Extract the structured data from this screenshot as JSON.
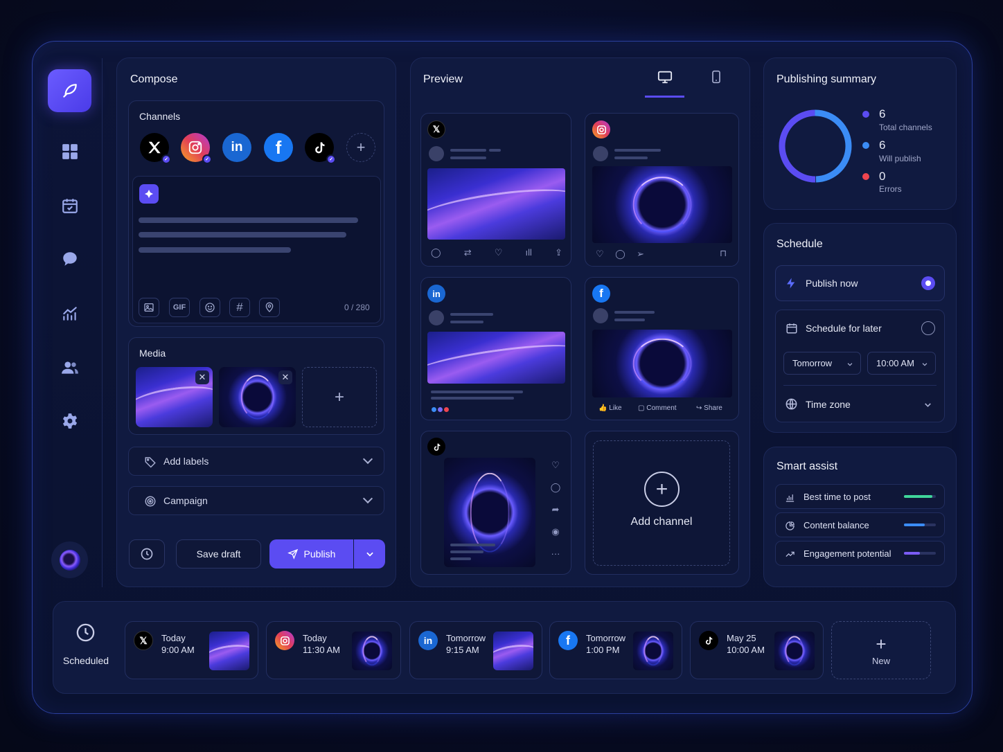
{
  "compose": {
    "title": "Compose",
    "channels_title": "Channels",
    "char_count": "0 / 280",
    "tools": [
      "image-icon",
      "GIF",
      "emoji-icon",
      "#",
      "location-icon"
    ],
    "media_title": "Media",
    "add_labels": "Add labels",
    "campaign": "Campaign",
    "save_draft": "Save draft",
    "publish": "Publish"
  },
  "preview": {
    "title": "Preview",
    "active_device": "desktop",
    "fb_like": "Like",
    "fb_comment": "Comment",
    "fb_share": "Share",
    "add_channel": "Add channel"
  },
  "summary": {
    "title": "Publishing summary",
    "total_value": "6",
    "total_label": "Total channels",
    "will_value": "6",
    "will_label": "Will publish",
    "errors_value": "0",
    "errors_label": "Errors",
    "colors": {
      "total": "#5b4cf2",
      "will": "#3b8cf5",
      "errors": "#f0454f"
    }
  },
  "schedule": {
    "title": "Schedule",
    "publish_now": "Publish now",
    "schedule_later": "Schedule for later",
    "day": "Tomorrow",
    "time": "10:00 AM",
    "timezone": "Time zone",
    "selected": "publish_now"
  },
  "assist": {
    "title": "Smart assist",
    "items": [
      {
        "label": "Best time to post",
        "level": 0.9,
        "color": "#3fd69a"
      },
      {
        "label": "Content balance",
        "level": 0.65,
        "color": "#3b8cf5"
      },
      {
        "label": "Engagement potential",
        "level": 0.5,
        "color": "#7b5cf5"
      }
    ]
  },
  "scheduled": {
    "label": "Scheduled",
    "items": [
      {
        "network": "X",
        "day": "Today",
        "time": "9:00 AM"
      },
      {
        "network": "Instagram",
        "day": "Today",
        "time": "11:30 AM"
      },
      {
        "network": "LinkedIn",
        "day": "Tomorrow",
        "time": "9:15 AM"
      },
      {
        "network": "Facebook",
        "day": "Tomorrow",
        "time": "1:00 PM"
      },
      {
        "network": "TikTok",
        "day": "May 25",
        "time": "10:00 AM"
      }
    ],
    "new_label": "New"
  }
}
